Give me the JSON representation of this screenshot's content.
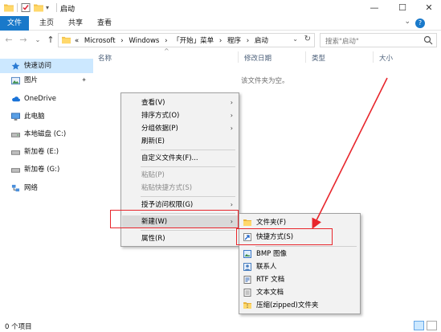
{
  "window": {
    "title": "启动",
    "minimize_glyph": "—",
    "maximize_glyph": "☐",
    "close_glyph": "✕"
  },
  "ribbon": {
    "tabs": [
      "文件",
      "主页",
      "共享",
      "查看"
    ],
    "expand_glyph": "⌄",
    "help_glyph": "?"
  },
  "nav": {
    "back_glyph": "←",
    "forward_glyph": "→",
    "recent_glyph": "⌄",
    "up_glyph": "↑",
    "breadcrumb": [
      "«",
      "Microsoft",
      "›",
      "Windows",
      "›",
      "「开始」菜单",
      "›",
      "程序",
      "›",
      "启动"
    ],
    "address_dropdown_glyph": "⌄",
    "refresh_glyph": "↻",
    "search_placeholder": "搜索\"启动\""
  },
  "sidebar": {
    "items": [
      {
        "label": "快速访问",
        "icon": "star-icon",
        "selected": true
      },
      {
        "label": "图片",
        "icon": "pictures-icon",
        "pinned": true
      },
      {
        "label": "OneDrive",
        "icon": "cloud-icon"
      },
      {
        "label": "此电脑",
        "icon": "computer-icon"
      },
      {
        "label": "本地磁盘 (C:)",
        "icon": "drive-icon"
      },
      {
        "label": "新加卷 (E:)",
        "icon": "drive-icon"
      },
      {
        "label": "新加卷 (G:)",
        "icon": "drive-icon"
      },
      {
        "label": "网络",
        "icon": "network-icon"
      }
    ],
    "pin_glyph": "📌"
  },
  "list": {
    "columns": [
      "名称",
      "修改日期",
      "类型",
      "大小"
    ],
    "sort_glyph": "^",
    "empty_message": "该文件夹为空。"
  },
  "context_menu": {
    "items": [
      {
        "label": "查看(V)",
        "submenu": true
      },
      {
        "label": "排序方式(O)",
        "submenu": true
      },
      {
        "label": "分组依据(P)",
        "submenu": true
      },
      {
        "label": "刷新(E)"
      },
      {
        "label": "自定义文件夹(F)..."
      },
      {
        "label": "粘贴(P)",
        "disabled": true
      },
      {
        "label": "粘贴快捷方式(S)",
        "disabled": true
      },
      {
        "label": "授予访问权限(G)",
        "submenu": true
      },
      {
        "label": "新建(W)",
        "submenu": true,
        "highlighted": true
      },
      {
        "label": "属性(R)"
      }
    ],
    "arrow_glyph": "›"
  },
  "new_submenu": {
    "items": [
      {
        "label": "文件夹(F)",
        "icon": "folder-icon"
      },
      {
        "label": "快捷方式(S)",
        "icon": "shortcut-icon"
      },
      {
        "label": "BMP 图像",
        "icon": "bmp-icon"
      },
      {
        "label": "联系人",
        "icon": "contact-icon"
      },
      {
        "label": "RTF 文档",
        "icon": "rtf-icon"
      },
      {
        "label": "文本文档",
        "icon": "text-doc-icon"
      },
      {
        "label": "压缩(zipped)文件夹",
        "icon": "zip-folder-icon"
      }
    ]
  },
  "status": {
    "item_count": "0 个项目"
  },
  "colors": {
    "accent": "#1979ca",
    "selection": "#cce8ff",
    "annotation": "#e8262c",
    "folder": "#f3c24a"
  }
}
